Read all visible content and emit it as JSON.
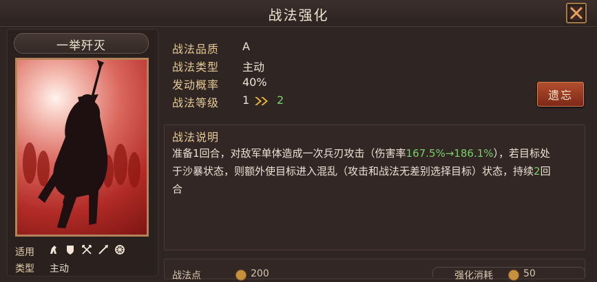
{
  "window": {
    "title": "战法强化",
    "close_icon": "close-icon"
  },
  "card": {
    "name": "一举歼灭",
    "applicable_label": "适用",
    "type_label": "类型",
    "type_value": "主动",
    "unit_icons": [
      "cavalry-icon",
      "shield-icon",
      "crossbow-icon",
      "spear-icon",
      "siege-wheel-icon"
    ]
  },
  "info": {
    "quality_label": "战法品质",
    "quality_value": "A",
    "type_label": "战法类型",
    "type_value": "主动",
    "rate_label": "发动概率",
    "rate_value": "40%",
    "level_label": "战法等级",
    "level_current": "1",
    "level_next": "2"
  },
  "forget_button": "遗忘",
  "description": {
    "title": "战法说明",
    "part1": "准备1回合，对敌军单体造成一次兵刃攻击（伤害率",
    "damage_rate": "167.5%→186.1%",
    "part2": "），若目标处于沙暴状态，则额外使目标进入混乱（攻击和战法无差别选择目标）状态，持续",
    "duration_num": "2",
    "part3": "回合"
  },
  "bottom": {
    "left_label": "战法点",
    "left_value": "200",
    "right_label": "强化消耗",
    "right_value": "50"
  },
  "colors": {
    "background": "#2f2523",
    "gold_label": "#e5c994",
    "highlight_green": "#79d06a",
    "forget_button": "#9a3a22",
    "art_red": "#b12b27"
  }
}
